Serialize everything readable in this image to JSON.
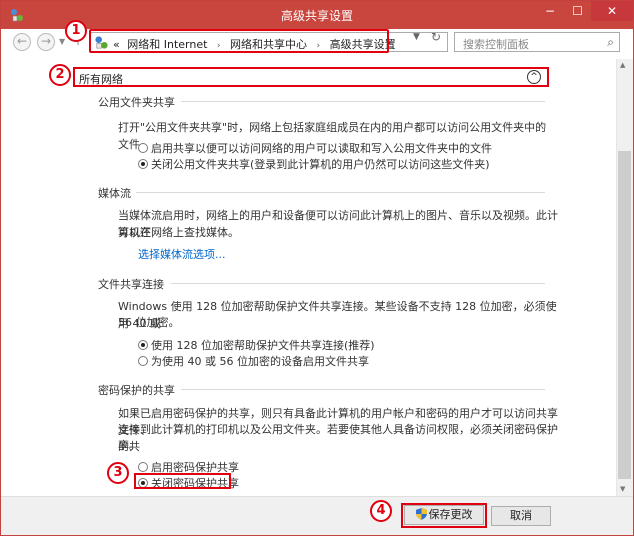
{
  "window": {
    "title": "高级共享设置",
    "min_label": "−",
    "max_label": "☐",
    "close_label": "✕"
  },
  "nav": {
    "back_icon": "arrow-left-icon",
    "forward_icon": "arrow-right-icon",
    "breadcrumb_prefix": "«",
    "breadcrumb": [
      "网络和 Internet",
      "网络和共享中心",
      "高级共享设置"
    ],
    "breadcrumb_sep": "›",
    "search_placeholder": "搜索控制面板"
  },
  "callouts": [
    "1",
    "2",
    "3",
    "4"
  ],
  "section": {
    "title": "所有网络",
    "collapse_glyph": "^"
  },
  "public_folder": {
    "heading": "公用文件夹共享",
    "description": "打开\"公用文件夹共享\"时，网络上包括家庭组成员在内的用户都可以访问公用文件夹中的文件。",
    "options": [
      {
        "label": "启用共享以便可以访问网络的用户可以读取和写入公用文件夹中的文件",
        "checked": false
      },
      {
        "label": "关闭公用文件夹共享(登录到此计算机的用户仍然可以访问这些文件夹)",
        "checked": true
      }
    ]
  },
  "media": {
    "heading": "媒体流",
    "description_line1": "当媒体流启用时，网络上的用户和设备便可以访问此计算机上的图片、音乐以及视频。此计算机还",
    "description_line2": "可以在网络上查找媒体。",
    "link": "选择媒体流选项..."
  },
  "file_sharing": {
    "heading": "文件共享连接",
    "description_line1": "Windows 使用 128 位加密帮助保护文件共享连接。某些设备不支持 128 位加密，必须使用 40 或",
    "description_line2": "56 位加密。",
    "options": [
      {
        "label": "使用 128 位加密帮助保护文件共享连接(推荐)",
        "checked": true
      },
      {
        "label": "为使用 40 或 56 位加密的设备启用文件共享",
        "checked": false
      }
    ]
  },
  "password": {
    "heading": "密码保护的共享",
    "description_line1": "如果已启用密码保护的共享，则只有具备此计算机的用户帐户和密码的用户才可以访问共享文件、",
    "description_line2": "连接到此计算机的打印机以及公用文件夹。若要使其他人具备访问权限，必须关闭密码保护的共",
    "description_line3": "享。",
    "options": [
      {
        "label": "启用密码保护共享",
        "checked": false
      },
      {
        "label": "关闭密码保护共享",
        "checked": true
      }
    ]
  },
  "buttons": {
    "save": "保存更改",
    "cancel": "取消"
  },
  "colors": {
    "titlebar": "#c9463f",
    "highlight": "#e0000f",
    "link": "#0066cc"
  }
}
